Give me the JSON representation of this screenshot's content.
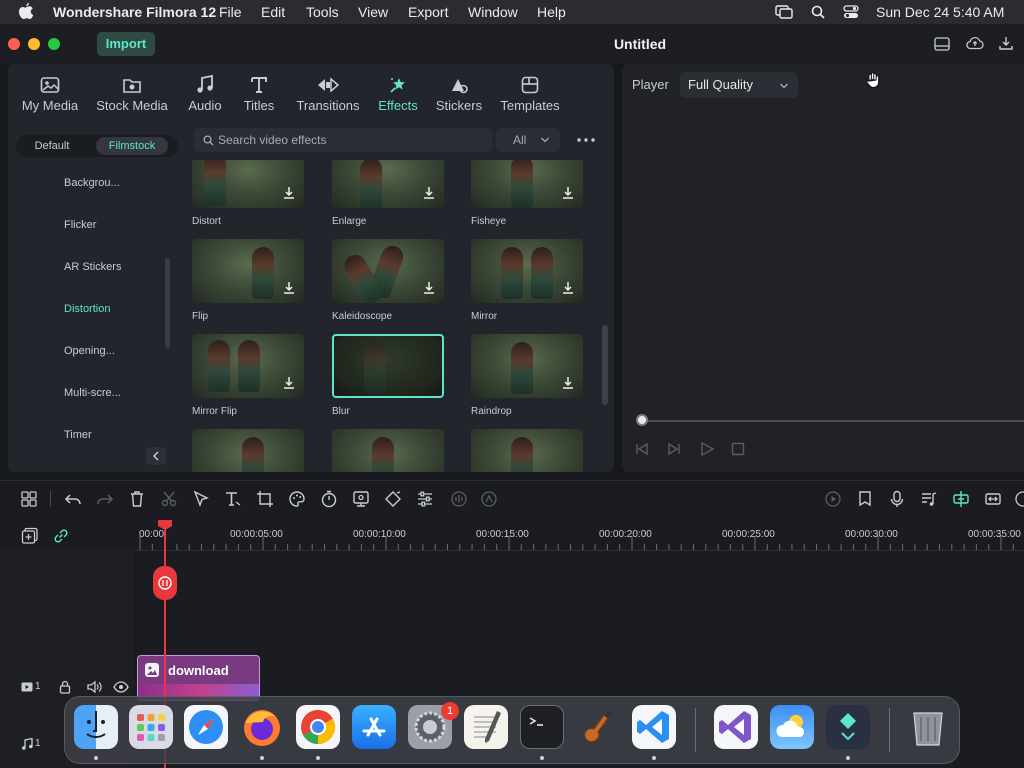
{
  "menubar": {
    "app_name": "Wondershare Filmora 12",
    "items": [
      "File",
      "Edit",
      "Tools",
      "View",
      "Export",
      "Window",
      "Help"
    ],
    "datetime": "Sun Dec 24  5:40 AM"
  },
  "titlebar": {
    "import_label": "Import",
    "title": "Untitled"
  },
  "media_tabs": [
    {
      "label": "My Media",
      "icon": "my-media-icon"
    },
    {
      "label": "Stock Media",
      "icon": "stock-media-icon"
    },
    {
      "label": "Audio",
      "icon": "audio-icon"
    },
    {
      "label": "Titles",
      "icon": "titles-icon"
    },
    {
      "label": "Transitions",
      "icon": "transitions-icon"
    },
    {
      "label": "Effects",
      "icon": "effects-icon"
    },
    {
      "label": "Stickers",
      "icon": "stickers-icon"
    },
    {
      "label": "Templates",
      "icon": "templates-icon"
    }
  ],
  "active_tab": "Effects",
  "segment": {
    "options": [
      "Default",
      "Filmstock"
    ],
    "selected": "Filmstock"
  },
  "categories": [
    "Backgrou...",
    "Flicker",
    "AR Stickers",
    "Distortion",
    "Opening...",
    "Multi-scre...",
    "Timer"
  ],
  "active_category": "Distortion",
  "search": {
    "placeholder": "Search video effects",
    "filter": "All"
  },
  "effects": [
    {
      "label": "Distort"
    },
    {
      "label": "Enlarge"
    },
    {
      "label": "Fisheye"
    },
    {
      "label": "Flip"
    },
    {
      "label": "Kaleidoscope"
    },
    {
      "label": "Mirror"
    },
    {
      "label": "Mirror Flip"
    },
    {
      "label": "Blur"
    },
    {
      "label": "Raindrop"
    },
    {
      "label": ""
    },
    {
      "label": ""
    },
    {
      "label": ""
    }
  ],
  "player": {
    "label": "Player",
    "quality": "Full Quality"
  },
  "ruler": [
    "00:00",
    "00:00:05:00",
    "00:00:10:00",
    "00:00:15:00",
    "00:00:20:00",
    "00:00:25:00",
    "00:00:30:00",
    "00:00:35:00"
  ],
  "tracks": {
    "video_label": "1",
    "audio_label": "1",
    "clip_label": "download"
  },
  "dock": {
    "apps": [
      "Finder",
      "Launchpad",
      "Safari",
      "Firefox",
      "Chrome",
      "App Store",
      "System Preferences",
      "TextEdit",
      "Terminal",
      "GarageBand",
      "Visual Studio Code",
      "Visual Studio",
      "Weather",
      "Filmora",
      "Trash"
    ],
    "badge": "1"
  },
  "colors": {
    "accent": "#5ee6c6",
    "playhead": "#e8383d",
    "menubar": "#2a2c31",
    "panel": "#22252b"
  }
}
